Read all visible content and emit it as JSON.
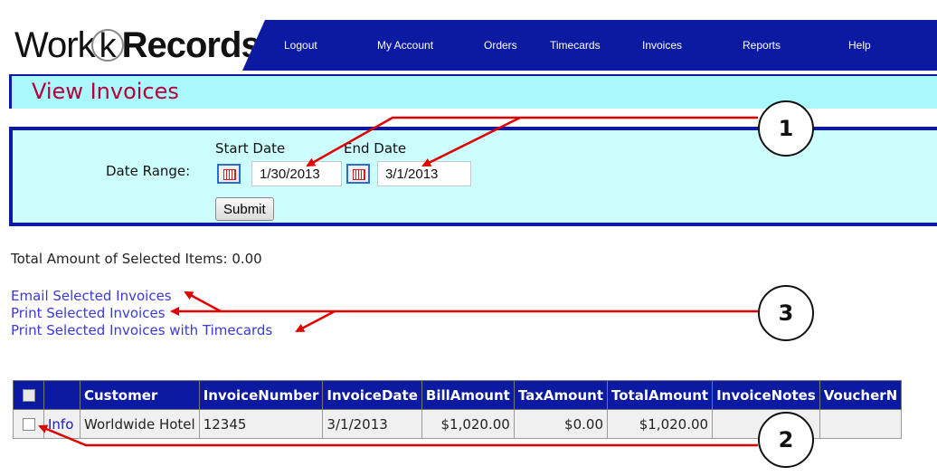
{
  "header": {
    "logo_part1": "Work",
    "logo_k": "k",
    "logo_part2": "Records",
    "nav": [
      "Logout",
      "My Account",
      "Orders",
      "Timecards",
      "Invoices",
      "Reports",
      "Help"
    ]
  },
  "page_title": "View Invoices",
  "date_form": {
    "range_label": "Date Range:",
    "start_label": "Start Date",
    "end_label": "End Date",
    "start_value": "1/30/2013",
    "end_value": "3/1/2013",
    "submit_label": "Submit"
  },
  "total_text": "Total Amount of Selected Items: 0.00",
  "actions": {
    "email": "Email Selected Invoices",
    "print": "Print Selected Invoices",
    "print_timecards": "Print Selected Invoices with Timecards"
  },
  "table": {
    "columns": [
      "Customer",
      "InvoiceNumber",
      "InvoiceDate",
      "BillAmount",
      "TaxAmount",
      "TotalAmount",
      "InvoiceNotes",
      "VoucherN"
    ],
    "rows": [
      {
        "info": "Info",
        "customer": "Worldwide Hotel",
        "invoice_number": "12345",
        "invoice_date": "3/1/2013",
        "bill_amount": "$1,020.00",
        "tax_amount": "$0.00",
        "total_amount": "$1,020.00",
        "invoice_notes": "",
        "voucher": ""
      }
    ]
  },
  "callouts": [
    "1",
    "2",
    "3"
  ],
  "colors": {
    "nav_bg": "#0b1aa0",
    "title_bg": "#aaf8fc",
    "form_bg": "#ccfefe",
    "title_text": "#b4003a",
    "link": "#3a3ad8",
    "arrow": "#e00000"
  }
}
